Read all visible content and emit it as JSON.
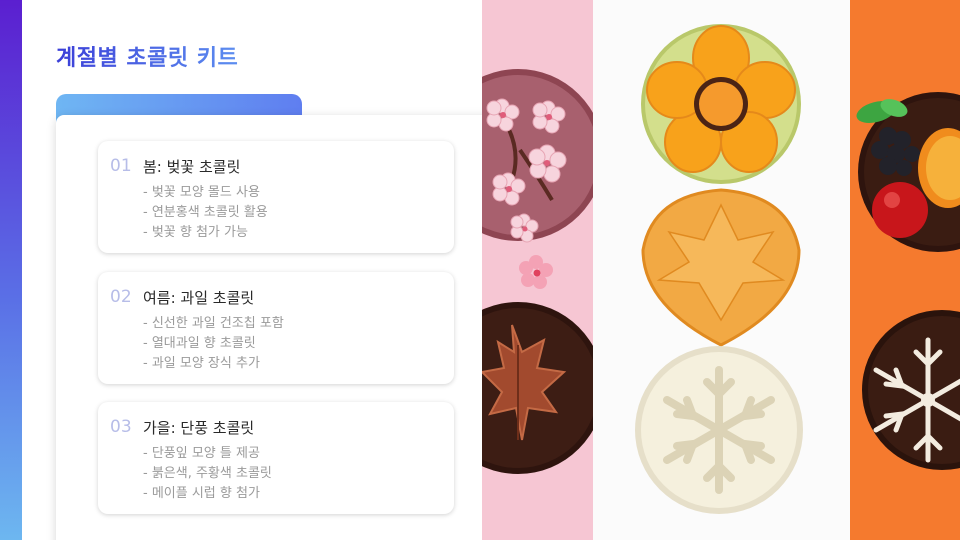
{
  "slide": {
    "title": "계절별 초콜릿 키트"
  },
  "seasons": [
    {
      "number": "01",
      "heading": "봄: 벚꽃 초콜릿",
      "bullets": [
        "- 벚꽃 모양 몰드 사용",
        "- 연분홍색 초콜릿 활용",
        "- 벚꽃 향 첨가 가능"
      ]
    },
    {
      "number": "02",
      "heading": "여름: 과일 초콜릿",
      "bullets": [
        "- 신선한 과일 건조칩 포함",
        "- 열대과일 향 초콜릿",
        "- 과일 모양 장식 추가"
      ]
    },
    {
      "number": "03",
      "heading": "가을: 단풍 초콜릿",
      "bullets": [
        "- 단풍잎 모양 틀 제공",
        "- 붉은색, 주황색 초콜릿",
        "- 메이플 시럽 향 첨가"
      ]
    }
  ],
  "colors": {
    "pink_panel": "#f6c6d3",
    "white_panel": "#ffffff",
    "orange_panel": "#f57a2e",
    "chocolate_dark": "#3d1d14",
    "chocolate_pink": "#a8606e"
  }
}
